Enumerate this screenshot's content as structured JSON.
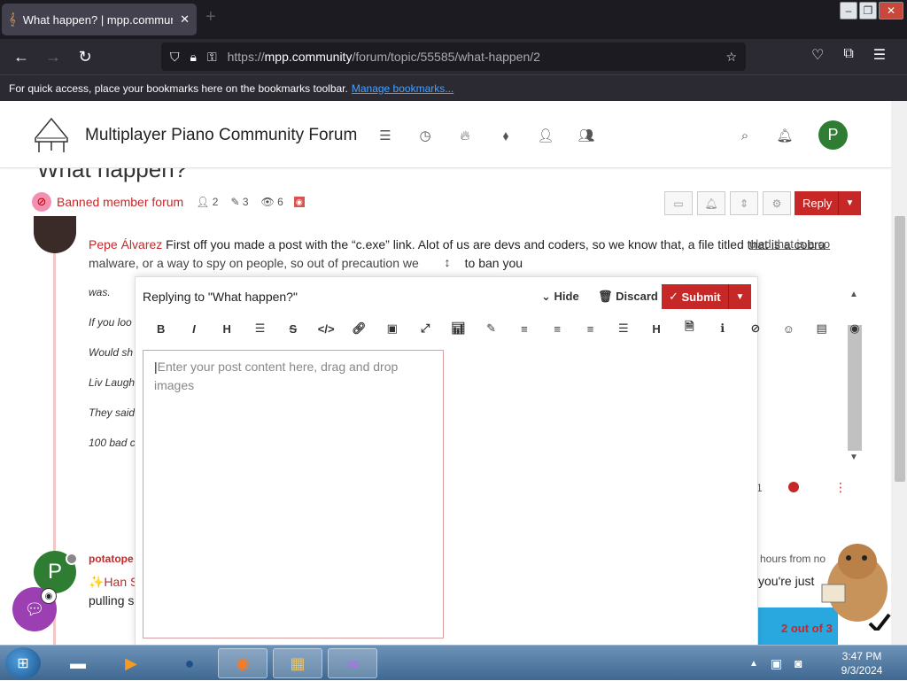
{
  "browser": {
    "tab_title": "What happen? | mpp.community",
    "url_host": "mpp.community",
    "url_path": "/forum/topic/55585/what-happen/2",
    "url_scheme": "https://",
    "bookmarks_text": "For quick access, place your bookmarks here on the bookmarks toolbar.",
    "bookmarks_link": "Manage bookmarks..."
  },
  "header": {
    "brand": "Multiplayer Piano Community Forum",
    "avatar_letter": "P"
  },
  "topic": {
    "title": "What happen?",
    "category": "Banned member forum",
    "posters": "2",
    "posts": "3",
    "views": "6",
    "reply_label": "Reply"
  },
  "post1": {
    "author": "Pepe Álvarez",
    "text_line1": "First off you made a post with the “c.exe” link. Alot of us are devs and coders, so we know that, a file titled that is a cobra",
    "text_line2": "malware, or a way to spy on people, so out of precaution we",
    "text_line2b": "to ban you",
    "right_link": "uled that is a co",
    "quotes": [
      "was.",
      "If you loo",
      "Would sh",
      "Liv Laugh",
      "They said",
      "100 bad c"
    ],
    "votes": "1"
  },
  "post2": {
    "avatar_letter": "P",
    "name": "potatope",
    "line1": "✨Han S",
    "line2": "pulling s",
    "time": "hours from no",
    "right_text": "you're just"
  },
  "pager": {
    "text": "2 out of 3"
  },
  "composer": {
    "title": "Replying to \"What happen?\"",
    "hide": "Hide",
    "discard": "Discard",
    "submit": "Submit",
    "placeholder": "Enter your post content here, drag and drop images"
  },
  "taskbar": {
    "time": "3:47 PM",
    "date": "9/3/2024"
  },
  "colors": {
    "accent": "#c62828",
    "brand_green": "#2e7d32"
  }
}
